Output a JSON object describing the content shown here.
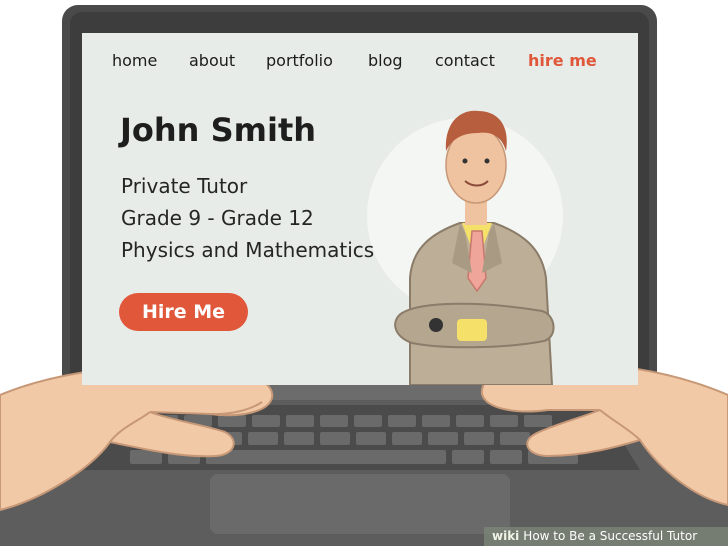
{
  "nav": {
    "home": "home",
    "about": "about",
    "portfolio": "portfolio",
    "blog": "blog",
    "contact": "contact",
    "hire": "hire me"
  },
  "profile": {
    "name": "John Smith",
    "role": "Private Tutor",
    "grades": "Grade 9 - Grade 12",
    "subjects": "Physics and Mathematics",
    "cta": "Hire Me"
  },
  "watermark": {
    "brand": "wiki",
    "title": "How to Be a Successful Tutor"
  },
  "colors": {
    "accent": "#e0573a",
    "screen_bg": "#e7ece8",
    "laptop_body": "#4a4a4a"
  }
}
